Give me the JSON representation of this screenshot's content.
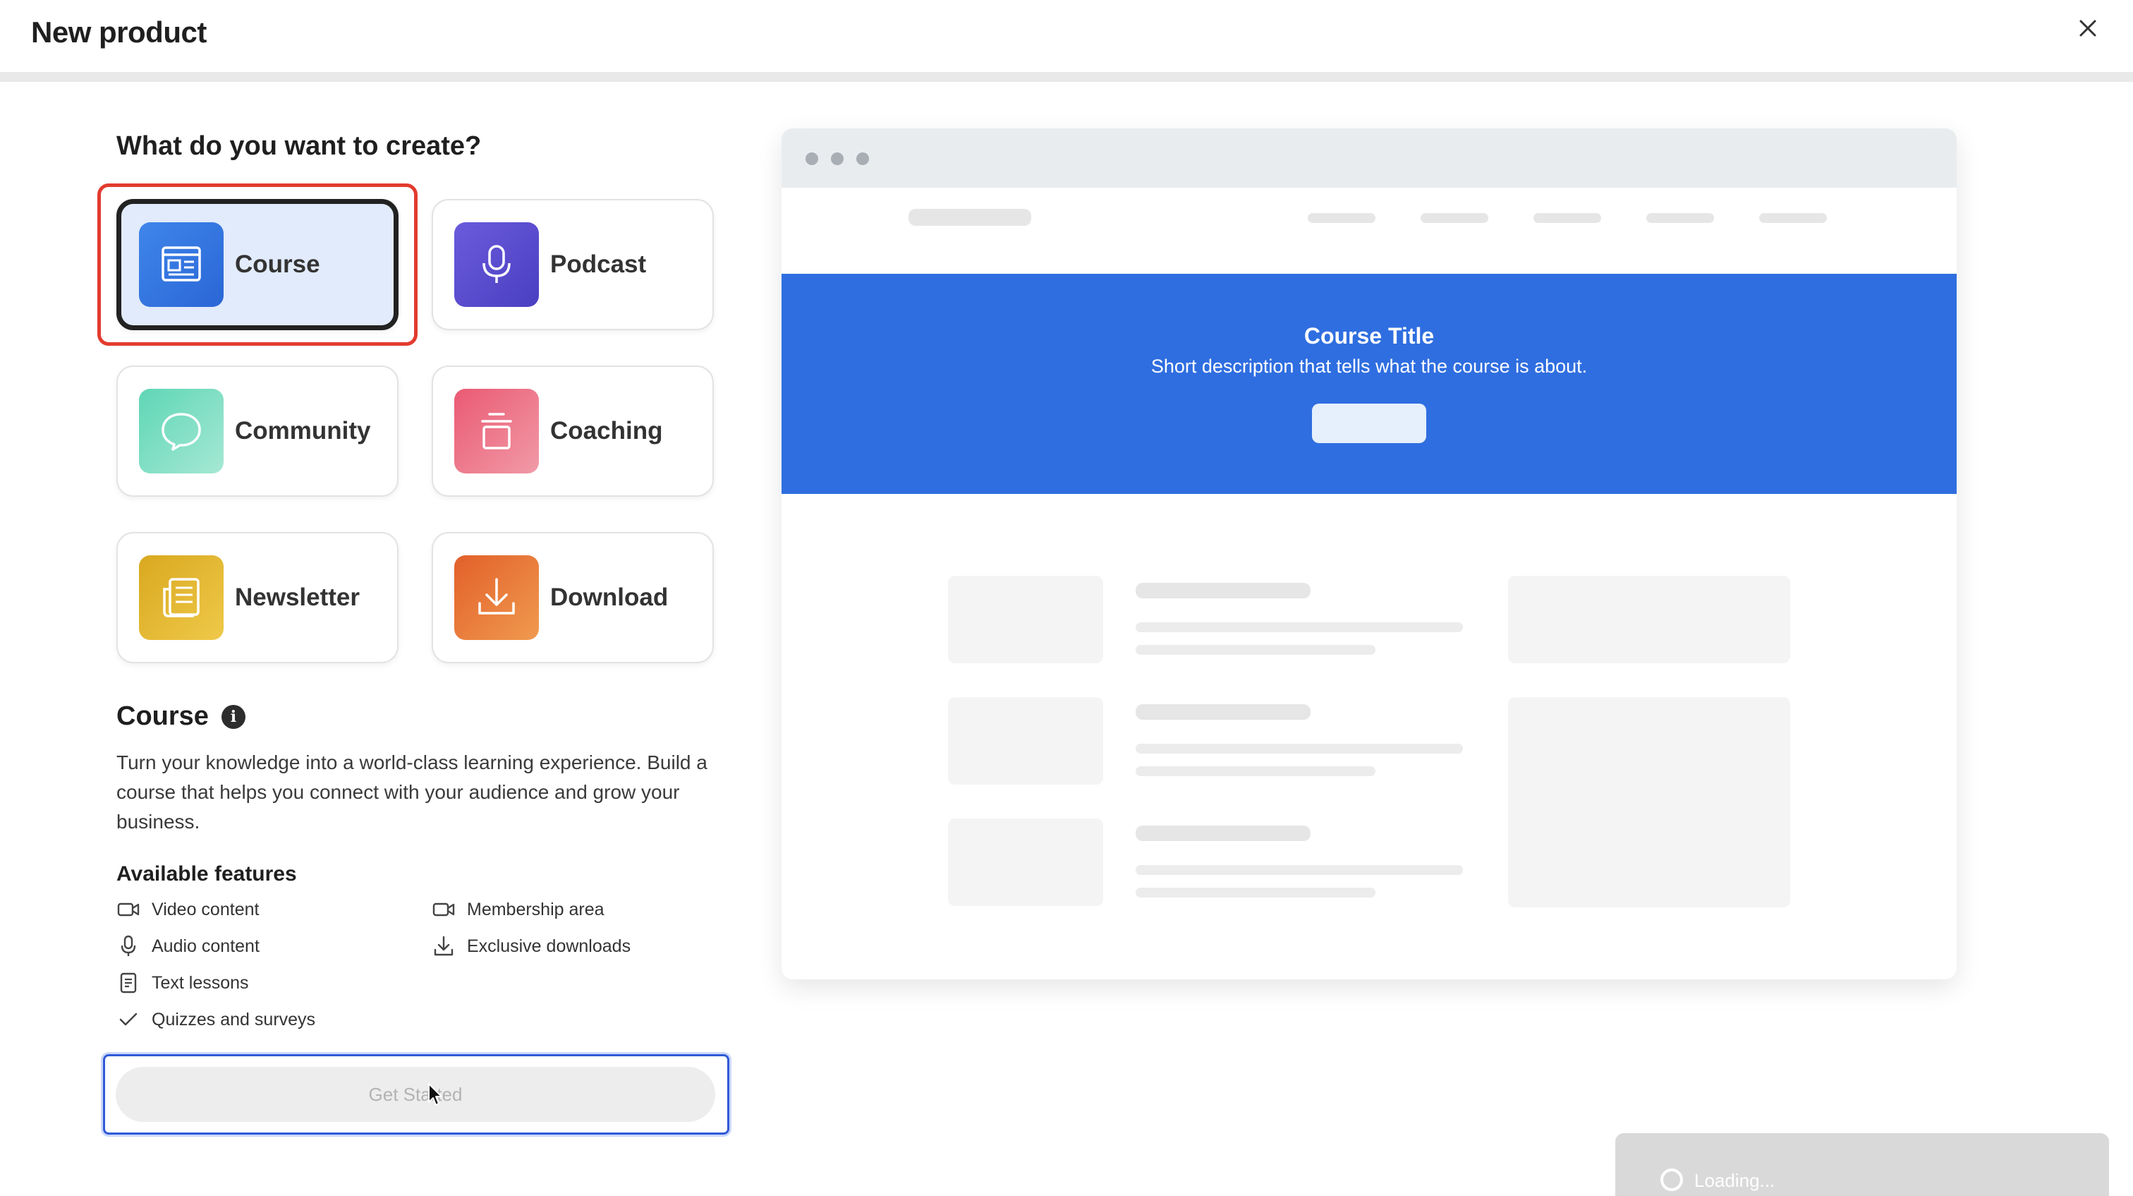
{
  "window": {
    "title": "New product",
    "close_label": "close"
  },
  "chooser": {
    "question": "What do you want to create?",
    "selected": "Course",
    "types": [
      {
        "label": "Course",
        "icon": "course-icon",
        "color": "#2f74e0"
      },
      {
        "label": "Podcast",
        "icon": "microphone-icon",
        "color": "#5b4fcf"
      },
      {
        "label": "Community",
        "icon": "chat-bubble-icon",
        "color": "#4fcfb3"
      },
      {
        "label": "Coaching",
        "icon": "coaching-icon",
        "color": "#e8627a"
      },
      {
        "label": "Newsletter",
        "icon": "newsletter-icon",
        "color": "#e0b22a"
      },
      {
        "label": "Download",
        "icon": "download-icon",
        "color": "#e8692a"
      }
    ]
  },
  "detail": {
    "title": "Course",
    "description": "Turn your knowledge into a world-class learning experience. Build a course that helps you connect with your audience and grow your business.",
    "features_title": "Available features",
    "features": [
      {
        "label": "Video content",
        "icon": "video-camera-icon"
      },
      {
        "label": "Membership area",
        "icon": "video-camera-icon"
      },
      {
        "label": "Audio content",
        "icon": "microphone-icon"
      },
      {
        "label": "Exclusive downloads",
        "icon": "download-icon"
      },
      {
        "label": "Text lessons",
        "icon": "document-icon"
      },
      {
        "label": "Quizzes and surveys",
        "icon": "checkmark-icon"
      }
    ],
    "cta_label": "Get Started"
  },
  "preview": {
    "hero_title": "Course Title",
    "hero_description": "Short description that tells what the course is about.",
    "hero_color": "#2f6ee0"
  },
  "toast": {
    "text": "Loading..."
  }
}
